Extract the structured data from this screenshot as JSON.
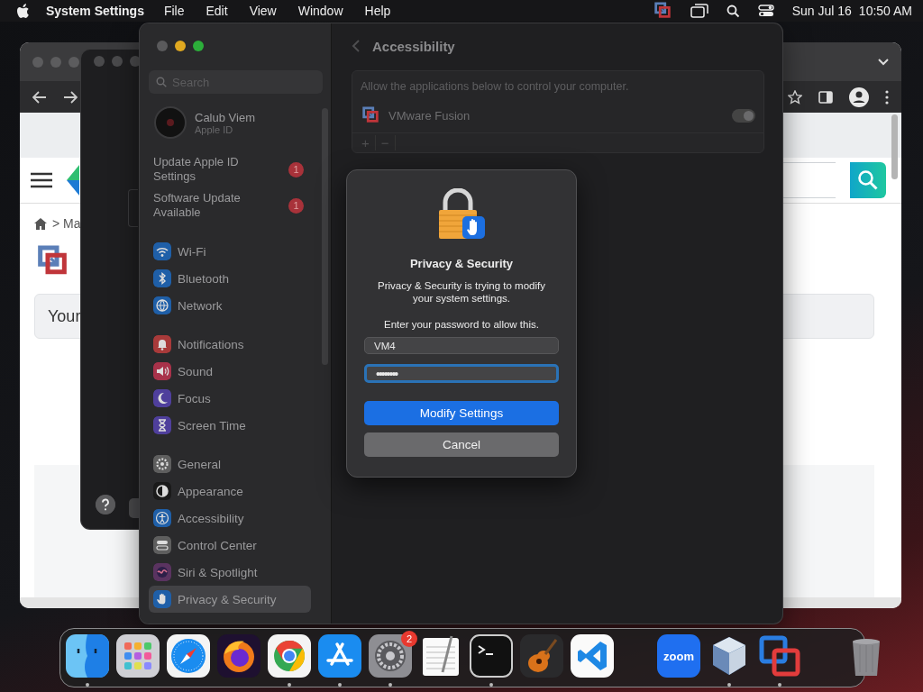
{
  "menu_bar": {
    "app_name": "System Settings",
    "menus": [
      "File",
      "Edit",
      "View",
      "Window",
      "Help"
    ],
    "date": "Sun Jul 16",
    "time": "10:50 AM"
  },
  "browser_window": {
    "breadcrumb": "> Ma",
    "banner_text": "Your"
  },
  "settings_window": {
    "search": {
      "placeholder": "Search"
    },
    "account": {
      "name": "Calub Viem",
      "subtitle": "Apple ID"
    },
    "alerts": [
      {
        "label": "Update Apple ID Settings",
        "badge": "1"
      },
      {
        "label": "Software Update Available",
        "badge": "1"
      }
    ],
    "sidebar_groups": [
      {
        "items": [
          {
            "label": "Wi-Fi",
            "color": "#1f5fa8",
            "selected": false
          },
          {
            "label": "Bluetooth",
            "color": "#1f5fa8",
            "selected": false
          },
          {
            "label": "Network",
            "color": "#1f5fa8",
            "selected": false
          }
        ]
      },
      {
        "items": [
          {
            "label": "Notifications",
            "color": "#a83a3a",
            "selected": false
          },
          {
            "label": "Sound",
            "color": "#a8324a",
            "selected": false
          },
          {
            "label": "Focus",
            "color": "#4f3f9c",
            "selected": false
          },
          {
            "label": "Screen Time",
            "color": "#4f3f9c",
            "selected": false
          }
        ]
      },
      {
        "items": [
          {
            "label": "General",
            "color": "#5e5e5e",
            "selected": false
          },
          {
            "label": "Appearance",
            "color": "#1a1a1a",
            "selected": false
          },
          {
            "label": "Accessibility",
            "color": "#1f5fa8",
            "selected": false
          },
          {
            "label": "Control Center",
            "color": "#5e5e5e",
            "selected": false
          },
          {
            "label": "Siri & Spotlight",
            "color": "#5a3360",
            "selected": false
          },
          {
            "label": "Privacy & Security",
            "color": "#1f5fa8",
            "selected": true
          }
        ]
      }
    ],
    "header_title": "Accessibility",
    "panel": {
      "description": "Allow the applications below to control your computer.",
      "apps": [
        {
          "name": "VMware Fusion",
          "on": true
        }
      ],
      "controls": [
        "+",
        "−"
      ]
    }
  },
  "dialog": {
    "title": "Privacy & Security",
    "message": "Privacy & Security is trying to modify your system settings.",
    "prompt": "Enter your password to allow this.",
    "username": "VM4",
    "password": "••••••••",
    "buttons": [
      {
        "label": "Modify Settings",
        "kind": "primary"
      },
      {
        "label": "Cancel",
        "kind": "secondary"
      }
    ]
  },
  "dock": {
    "apps": [
      {
        "running": true
      },
      {
        "running": false
      },
      {
        "running": false
      },
      {
        "running": false
      },
      {
        "running": true
      },
      {
        "running": true
      },
      {
        "running": true,
        "badge": "2"
      },
      {
        "running": false
      },
      {
        "running": true
      },
      {
        "running": false
      },
      {
        "running": false
      },
      {
        "running": false,
        "label": "zoom"
      },
      {
        "running": true
      },
      {
        "running": true
      },
      {
        "running": false
      }
    ]
  }
}
